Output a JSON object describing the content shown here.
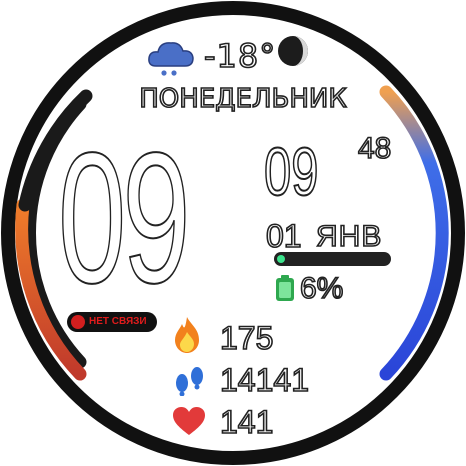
{
  "weather": {
    "icon": "snow-cloud-icon",
    "temperature": "-18°"
  },
  "moon": {
    "icon": "moon-phase-icon"
  },
  "date": {
    "weekday": "ПОНЕДЕЛЬНИК",
    "day": "01",
    "month": "ЯНВ"
  },
  "time": {
    "hour": "09",
    "minute": "09",
    "second": "48"
  },
  "battery": {
    "icon": "battery-icon",
    "percent_text": "6%",
    "level": 0.06,
    "fill_color": "#3be38c"
  },
  "connection": {
    "icon": "phone-disconnected-icon",
    "status_text": "НЕТ СВЯЗИ",
    "color": "#e01c1c"
  },
  "activity": {
    "calories_icon": "fire-icon",
    "calories": "175",
    "steps_icon": "footsteps-icon",
    "steps": "14141",
    "heart_icon": "heart-icon",
    "heart_rate": "141"
  },
  "gauges": {
    "left_level": 0.45,
    "right_level": 1.0,
    "left_colors": [
      "#c0392b",
      "#f07d2a"
    ],
    "right_colors": [
      "#2f4fe0",
      "#f0a050"
    ]
  },
  "colors": {
    "background": "#ffffff",
    "ring": "#111111",
    "outline": "#222222"
  }
}
